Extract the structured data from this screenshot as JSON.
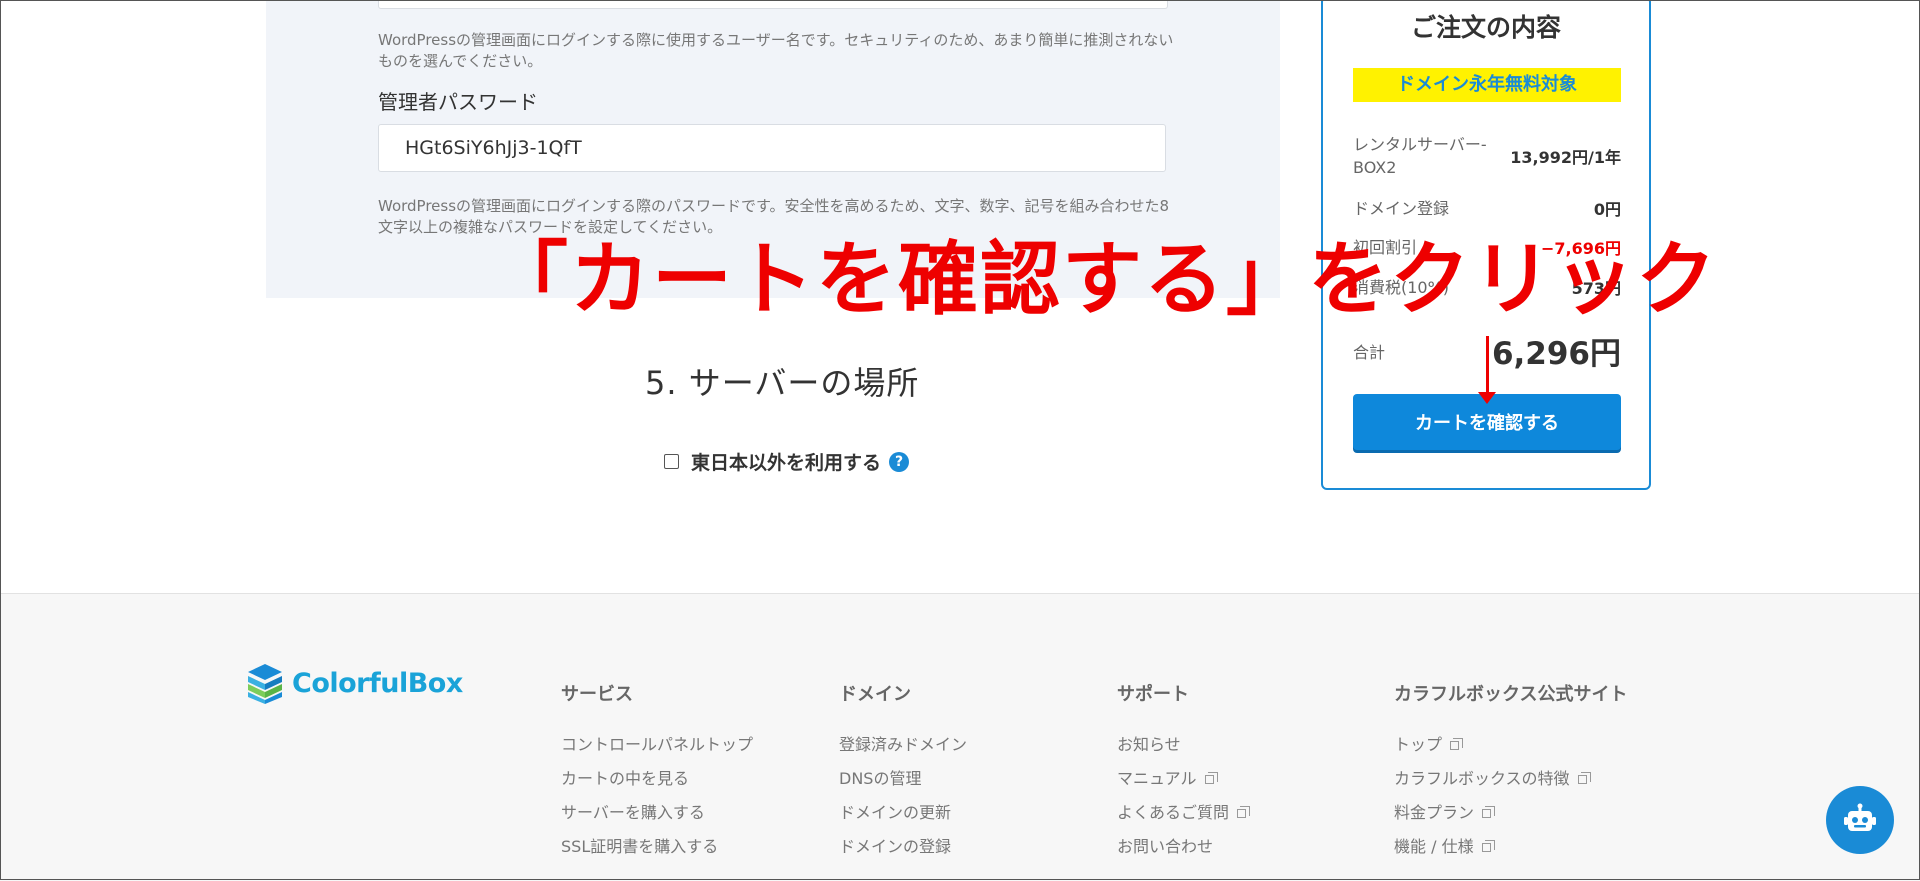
{
  "form": {
    "username_help": "WordPressの管理画面にログインする際に使用するユーザー名です。セキュリティのため、あまり簡単に推測されないものを選んでください。",
    "password_label": "管理者パスワード",
    "password_value": "HGt6SiY6hJj3-1QfT",
    "password_help": "WordPressの管理画面にログインする際のパスワードです。安全性を高めるため、文字、数字、記号を組み合わせた8文字以上の複雑なパスワードを設定してください。"
  },
  "server_location": {
    "title": "5. サーバーの場所",
    "checkbox_label": "東日本以外を利用する",
    "help_icon": "?"
  },
  "order": {
    "title": "ご注文の内容",
    "badge": "ドメイン永年無料対象",
    "rows": [
      {
        "label": "レンタルサーバー-BOX2",
        "value": "13,992円/1年"
      },
      {
        "label": "ドメイン登録",
        "value": "0円"
      },
      {
        "label": "初回割引",
        "value": "−7,696円"
      },
      {
        "label": "消費税(10%)",
        "value": "573円"
      }
    ],
    "total_label": "合計",
    "total_value": "6,296円",
    "cart_button": "カートを確認する",
    "discount_color": "#ee0000"
  },
  "annotation": {
    "text": "「カートを確認する」をクリック",
    "color": "#ee0000"
  },
  "footer": {
    "logo_text": "ColorfulBox",
    "columns": [
      {
        "title": "サービス",
        "items": [
          {
            "label": "コントロールパネルトップ",
            "external": false
          },
          {
            "label": "カートの中を見る",
            "external": false
          },
          {
            "label": "サーバーを購入する",
            "external": false
          },
          {
            "label": "SSL証明書を購入する",
            "external": false
          }
        ]
      },
      {
        "title": "ドメイン",
        "items": [
          {
            "label": "登録済みドメイン",
            "external": false
          },
          {
            "label": "DNSの管理",
            "external": false
          },
          {
            "label": "ドメインの更新",
            "external": false
          },
          {
            "label": "ドメインの登録",
            "external": false
          }
        ]
      },
      {
        "title": "サポート",
        "items": [
          {
            "label": "お知らせ",
            "external": false
          },
          {
            "label": "マニュアル",
            "external": true
          },
          {
            "label": "よくあるご質問",
            "external": true
          },
          {
            "label": "お問い合わせ",
            "external": false
          }
        ]
      },
      {
        "title": "カラフルボックス公式サイト",
        "items": [
          {
            "label": "トップ",
            "external": true
          },
          {
            "label": "カラフルボックスの特徴",
            "external": true
          },
          {
            "label": "料金プラン",
            "external": true
          },
          {
            "label": "機能 / 仕様",
            "external": true
          }
        ]
      }
    ]
  },
  "colors": {
    "accent": "#1a8bd6",
    "button": "#0e88db",
    "badge_bg": "#fff200",
    "panel_bg": "#f1f4f9",
    "footer_bg": "#f7f7f7"
  },
  "icons": {
    "external_link": "external-link-icon",
    "chat_bot": "robot-icon",
    "help": "question-icon"
  }
}
